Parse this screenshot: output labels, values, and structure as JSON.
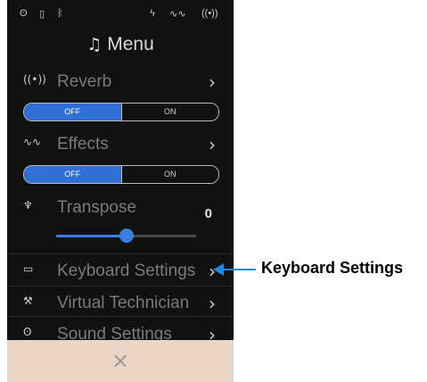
{
  "status_bar": {
    "headphone_icon": "headphones",
    "lock_icon": "lock",
    "bluetooth_icon": "bluetooth",
    "flash_icon": "flash",
    "effects_icon": "effects",
    "reverb_icon": "reverb"
  },
  "menu": {
    "title": "Menu",
    "reverb": {
      "label": "Reverb",
      "toggle_off": "OFF",
      "toggle_on": "ON"
    },
    "effects": {
      "label": "Effects",
      "toggle_off": "OFF",
      "toggle_on": "ON"
    },
    "transpose": {
      "label": "Transpose",
      "value": "0",
      "slider_fraction": 0.5
    },
    "keyboard_settings": {
      "label": "Keyboard Settings"
    },
    "virtual_technician": {
      "label": "Virtual Technician"
    },
    "sound_settings": {
      "label": "Sound Settings"
    },
    "close_label": "×"
  },
  "annotation": {
    "text": "Keyboard Settings"
  },
  "colors": {
    "accent": "#2f6fd6",
    "callout": "#1e88e5",
    "close_bar": "#e9d6c7",
    "screen_bg": "#111111"
  }
}
